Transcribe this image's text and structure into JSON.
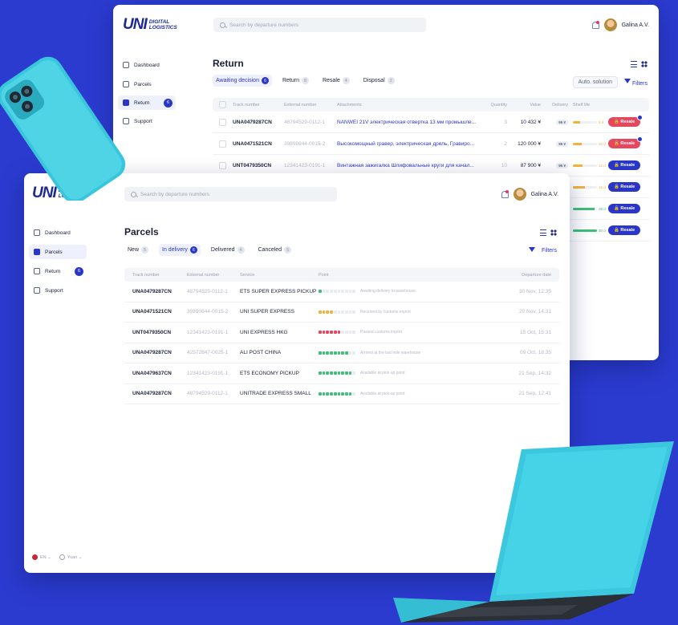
{
  "brand": {
    "uni": "UNI",
    "line1": "DIGITAL",
    "line2": "LOGISTICS"
  },
  "search": {
    "placeholder": "Search by departure numbers"
  },
  "user": {
    "name": "Galina A.V."
  },
  "sidebar": {
    "items": [
      {
        "label": "Dashboard",
        "icon": "dashboard-icon"
      },
      {
        "label": "Parcels",
        "icon": "parcels-icon"
      },
      {
        "label": "Return",
        "icon": "return-icon",
        "count": "6"
      },
      {
        "label": "Support",
        "icon": "support-icon"
      }
    ]
  },
  "return_view": {
    "title": "Return",
    "tabs": [
      {
        "label": "Awaiting decision",
        "count": "6"
      },
      {
        "label": "Return",
        "count": "8"
      },
      {
        "label": "Resale",
        "count": "4"
      },
      {
        "label": "Disposal",
        "count": "2"
      }
    ],
    "auto_solution": "Auto. solution",
    "filters": "Filters",
    "columns": [
      "Track number",
      "External number",
      "Attachments",
      "Quantity",
      "Value",
      "Delivery",
      "Shelf life"
    ],
    "rows": [
      {
        "track": "UNA0479287CN",
        "ext": "48794529-0112-1",
        "attach": "NANWEI 21V электрическая отвертка 13 мм промышле...",
        "qty": "3",
        "value": "10 432 ¥",
        "delivery": "95 ¥",
        "shelf": "9 d",
        "shelf_pct": 0.3,
        "shelf_color": "#f2b33d",
        "action": "Resale",
        "tone": "red",
        "dot": true
      },
      {
        "track": "UNA0471521CN",
        "ext": "39890844-0015-2",
        "attach": "Высокомощный гравер, электрическая дрель, Гравиро...",
        "qty": "2",
        "value": "120 000 ¥",
        "delivery": "95 ¥",
        "shelf": "10 d",
        "shelf_pct": 0.35,
        "shelf_color": "#f2b33d",
        "action": "Resale",
        "tone": "red",
        "dot": true
      },
      {
        "track": "UNT0479350CN",
        "ext": "12341423-0191-1",
        "attach": "Винтажная зажигалка Шлифовальные круги для качал...",
        "qty": "10",
        "value": "87 900 ¥",
        "delivery": "95 ¥",
        "shelf": "12 d",
        "shelf_pct": 0.4,
        "shelf_color": "#f2b33d",
        "action": "Resale",
        "tone": "blue",
        "dot": false
      },
      {
        "shelf": "15 d",
        "shelf_pct": 0.5,
        "shelf_color": "#f2b33d",
        "action": "Resale"
      },
      {
        "shelf": "28 d",
        "shelf_pct": 0.9,
        "shelf_color": "#3fc07a",
        "action": "Resale"
      },
      {
        "shelf": "30 d",
        "shelf_pct": 1.0,
        "shelf_color": "#3fc07a",
        "action": "Resale"
      }
    ]
  },
  "parcels_view": {
    "title": "Parcels",
    "tabs": [
      {
        "label": "New",
        "count": "5"
      },
      {
        "label": "In delivery",
        "count": "6"
      },
      {
        "label": "Delivered",
        "count": "4"
      },
      {
        "label": "Canceled",
        "count": "5"
      }
    ],
    "filters": "Filters",
    "columns": [
      "Track number",
      "External number",
      "Service",
      "Point",
      "Departure date"
    ],
    "rows": [
      {
        "track": "UNA0479287CN",
        "ext": "48794529-0112-1",
        "service": "ETS SUPER EXPRESS PICKUP",
        "point": "Awaiting delivery to warehouse",
        "progress": 1,
        "color": "#3fc07a",
        "date": "30 Nov, 12:35"
      },
      {
        "track": "UNA0471521CN",
        "ext": "39890844-0015-2",
        "service": "UNI SUPER EXPRESS",
        "point": "Received by customs export",
        "progress": 4,
        "color": "#f2b33d",
        "date": "20 Nov, 14:31"
      },
      {
        "track": "UNT0479350CN",
        "ext": "12341423-0191-1",
        "service": "UNI EXPRESS HKG",
        "point": "Passed customs import",
        "progress": 6,
        "color": "#e6475f",
        "date": "15 Oct, 15:31"
      },
      {
        "track": "UNA0479287CN",
        "ext": "42572847-0025-1",
        "service": "ALI POST CHINA",
        "point": "Arrived at the last mile warehouse",
        "progress": 8,
        "color": "#3fc07a",
        "date": "09 Oct, 18:35"
      },
      {
        "track": "UNA0479637CN",
        "ext": "12341423-0191-1",
        "service": "ETS ECONOMY PICKUP",
        "point": "Available at pick-up point",
        "progress": 9,
        "color": "#3fc07a",
        "date": "21 Sep, 14:32"
      },
      {
        "track": "UNA0479287CN",
        "ext": "48794529-0112-1",
        "service": "UNITRADE EXPRESS SMALL",
        "point": "Available at pick-up point",
        "progress": 9,
        "color": "#3fc07a",
        "date": "21 Sep, 12:41"
      }
    ]
  },
  "footer": {
    "lang": "EN",
    "currency": "Yuan"
  }
}
